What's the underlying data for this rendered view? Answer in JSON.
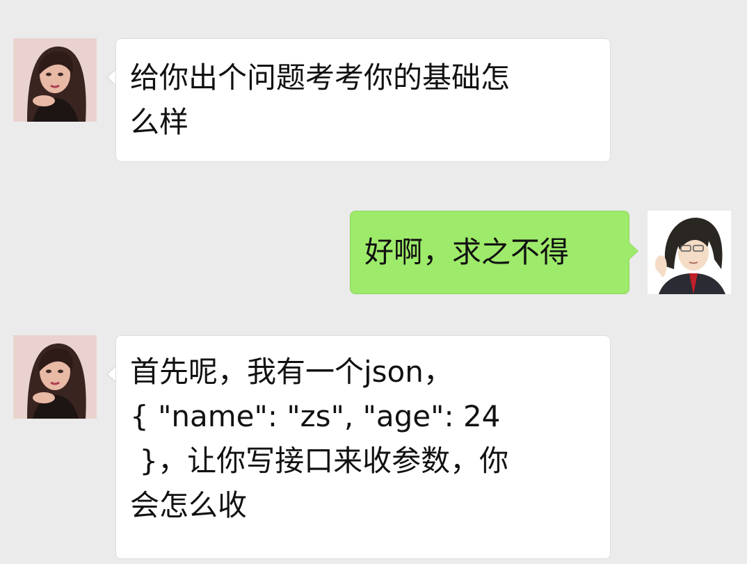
{
  "colors": {
    "background": "#ebebeb",
    "incoming_bubble": "#ffffff",
    "outgoing_bubble": "#9eea6a"
  },
  "messages": [
    {
      "sender": "other",
      "avatar": "female-avatar-icon",
      "lines": [
        "给你出个问题考考你的基础怎",
        "么样"
      ]
    },
    {
      "sender": "self",
      "avatar": "male-avatar-icon",
      "lines": [
        "好啊，求之不得"
      ]
    },
    {
      "sender": "other",
      "avatar": "female-avatar-icon",
      "lines": [
        "首先呢，我有一个json，",
        "{ \"name\": \"zs\", \"age\": 24",
        " }，让你写接口来收参数，你",
        "会怎么收"
      ]
    }
  ]
}
